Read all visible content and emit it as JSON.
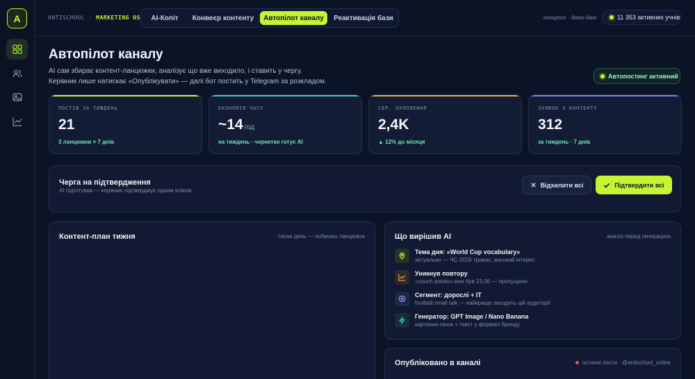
{
  "sidebar": {
    "logo": "A",
    "items": [
      {
        "icon": "dashboard-icon",
        "active": true
      },
      {
        "icon": "users-icon",
        "active": false
      },
      {
        "icon": "image-icon",
        "active": false
      },
      {
        "icon": "chart-icon",
        "active": false
      }
    ]
  },
  "topbar": {
    "brand_prefix": "ANTISCHOOL ·",
    "brand_highlight": "MARKETING OS",
    "tabs": [
      {
        "label": "AI-Копіт"
      },
      {
        "label": "Конвеєр контенту"
      },
      {
        "label": "Автопілот каналу"
      },
      {
        "label": "Реактивація бази"
      }
    ],
    "active_tab": 2,
    "demo_note": "концепт · демо-дані",
    "students": "11 353 активних учнів"
  },
  "header": {
    "title": "Автопілот каналу",
    "subtitle_line1": "AI сам збирає контент-ланцюжки, аналізує що вже виходило, і ставить у чергу.",
    "subtitle_line2": "Керівник лише натискає «Опублікувати» — далі бот постить у Telegram за розкладом.",
    "autopost_status": "Автопостинг активний"
  },
  "stats": [
    {
      "label": "ПОСТІВ ЗА ТИЖДЕНЬ",
      "value": "21",
      "unit": "",
      "note": "3 ланцюжки × 7 днів",
      "accent": "#c6f432"
    },
    {
      "label": "ЕКОНОМІЯ ЧАСУ",
      "value": "~14",
      "unit": "год",
      "note": "на тиждень · чернетки готує AI",
      "accent": "#3ecfb8"
    },
    {
      "label": "СЕР. ОХОПЛЕННЯ",
      "value": "2,4K",
      "unit": "",
      "note": "▲ 12% до місяця",
      "accent": "#e8a94a"
    },
    {
      "label": "ЗАЯВОК З КОНТЕНТУ",
      "value": "312",
      "unit": "",
      "note": "за тиждень · 7 днів",
      "accent": "#8b7cf0"
    }
  ],
  "queue": {
    "title": "Черга на підтвердження",
    "subtitle": "AI підготував — керівник підтверджує одним кліком",
    "reject_label": "Відхилити всі",
    "approve_label": "Підтвердити всі"
  },
  "content_plan": {
    "title": "Контент-план тижня",
    "hint": "тисни день — побачиш ланцюжок"
  },
  "ai_decisions": {
    "title": "Що вирішив AI",
    "hint": "аналіз перед генерацією",
    "items": [
      {
        "icon": "pin-icon",
        "color": "#c6f432",
        "bg": "#23322a",
        "title": "Тема дня: «World Cup vocabulary»",
        "subtitle": "актуально — ЧС-2026 триває, високий інтерес"
      },
      {
        "icon": "trend-icon",
        "color": "#e8a94a",
        "bg": "#30292a",
        "title": "Уникнув повтору",
        "subtitle": "«couch potato» вже був 23.06 — пропущено"
      },
      {
        "icon": "target-icon",
        "color": "#8b9cf0",
        "bg": "#1f2848",
        "title": "Сегмент: дорослі + IT",
        "subtitle": "football small talk — найкраще заходить цій аудиторії"
      },
      {
        "icon": "bolt-icon",
        "color": "#3ecfb8",
        "bg": "#15303a",
        "title": "Генератор: GPT Image / Nano Banana",
        "subtitle": "картинка-гачок + текст у форматі бренду"
      }
    ]
  },
  "published": {
    "title": "Опубліковано в каналі",
    "hint": "останні пости · @antischool_online"
  }
}
